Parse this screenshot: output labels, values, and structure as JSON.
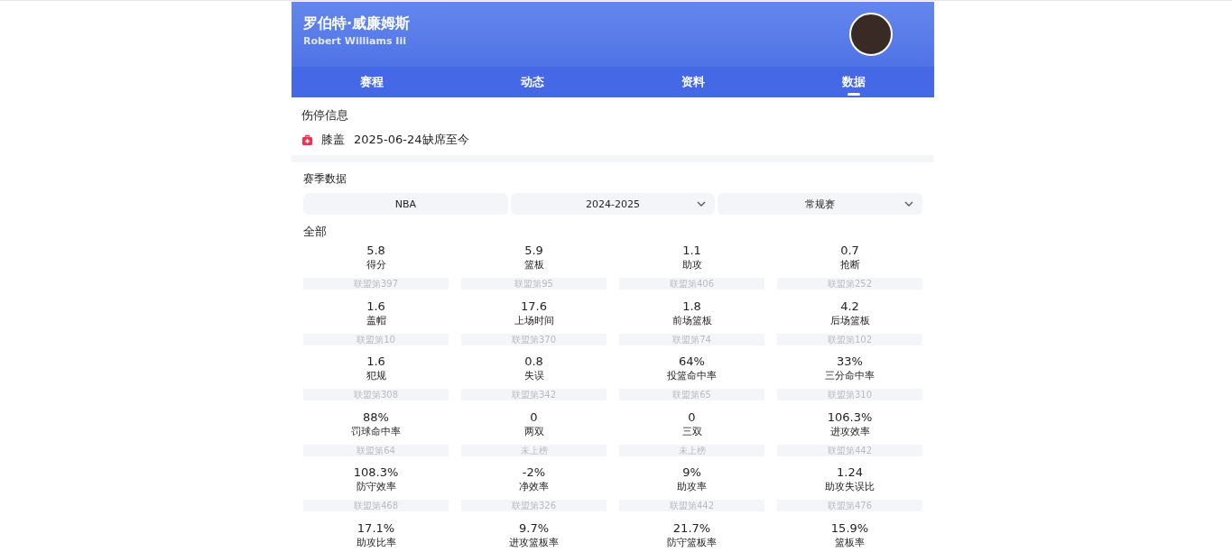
{
  "header": {
    "name": "罗伯特·威廉姆斯",
    "name_en": "Robert Williams Iii"
  },
  "tabs": [
    {
      "label": "赛程",
      "selected": false
    },
    {
      "label": "动态",
      "selected": false
    },
    {
      "label": "资料",
      "selected": false
    },
    {
      "label": "数据",
      "selected": true
    }
  ],
  "injury": {
    "title": "伤停信息",
    "part": "膝盖",
    "status": "2025-06-24缺席至今"
  },
  "season": {
    "title": "赛季数据",
    "filters": [
      {
        "value": "NBA",
        "dropdown": false
      },
      {
        "value": "2024-2025",
        "dropdown": true
      },
      {
        "value": "常规赛",
        "dropdown": true
      }
    ],
    "group": "全部",
    "stats": [
      {
        "value": "5.8",
        "label": "得分",
        "rank": "联盟第397"
      },
      {
        "value": "5.9",
        "label": "篮板",
        "rank": "联盟第95"
      },
      {
        "value": "1.1",
        "label": "助攻",
        "rank": "联盟第406"
      },
      {
        "value": "0.7",
        "label": "抢断",
        "rank": "联盟第252"
      },
      {
        "value": "1.6",
        "label": "盖帽",
        "rank": "联盟第10"
      },
      {
        "value": "17.6",
        "label": "上场时间",
        "rank": "联盟第370"
      },
      {
        "value": "1.8",
        "label": "前场篮板",
        "rank": "联盟第74"
      },
      {
        "value": "4.2",
        "label": "后场篮板",
        "rank": "联盟第102"
      },
      {
        "value": "1.6",
        "label": "犯规",
        "rank": "联盟第308"
      },
      {
        "value": "0.8",
        "label": "失误",
        "rank": "联盟第342"
      },
      {
        "value": "64%",
        "label": "投篮命中率",
        "rank": "联盟第65"
      },
      {
        "value": "33%",
        "label": "三分命中率",
        "rank": "联盟第310"
      },
      {
        "value": "88%",
        "label": "罚球命中率",
        "rank": "联盟第64"
      },
      {
        "value": "0",
        "label": "两双",
        "rank": "未上榜"
      },
      {
        "value": "0",
        "label": "三双",
        "rank": "未上榜"
      },
      {
        "value": "106.3%",
        "label": "进攻效率",
        "rank": "联盟第442"
      },
      {
        "value": "108.3%",
        "label": "防守效率",
        "rank": "联盟第468"
      },
      {
        "value": "-2%",
        "label": "净效率",
        "rank": "联盟第326"
      },
      {
        "value": "9%",
        "label": "助攻率",
        "rank": "联盟第442"
      },
      {
        "value": "1.24",
        "label": "助攻失误比",
        "rank": "联盟第476"
      },
      {
        "value": "17.1%",
        "label": "助攻比率"
      },
      {
        "value": "9.7%",
        "label": "进攻篮板率"
      },
      {
        "value": "21.7%",
        "label": "防守篮板率"
      },
      {
        "value": "15.9%",
        "label": "篮板率"
      }
    ]
  }
}
